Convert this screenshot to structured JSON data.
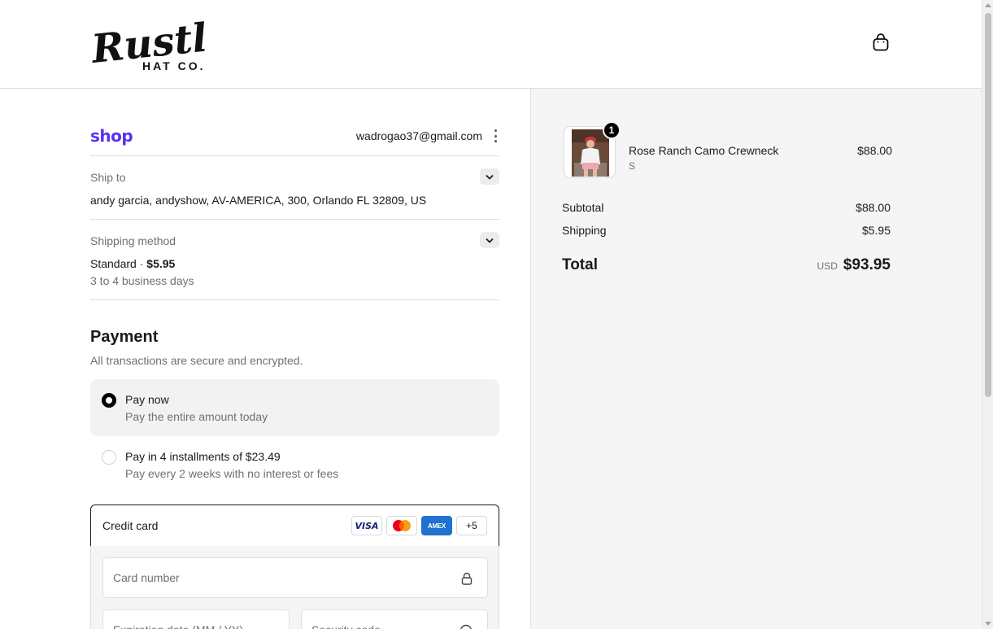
{
  "header": {
    "logo_script": "Rustler",
    "logo_sub": "HAT CO.",
    "cart_icon": "shopping-bag-icon"
  },
  "shop": {
    "brand": "shop",
    "email": "wadrogao37@gmail.com"
  },
  "ship_to": {
    "label": "Ship to",
    "value": "andy garcia, andyshow, AV-AMERICA, 300, Orlando FL 32809, US"
  },
  "shipping_method": {
    "label": "Shipping method",
    "name": "Standard",
    "separator": " · ",
    "price": "$5.95",
    "eta": "3 to 4 business days"
  },
  "payment": {
    "title": "Payment",
    "subtitle": "All transactions are secure and encrypted.",
    "options": [
      {
        "title": "Pay now",
        "subtitle": "Pay the entire amount today",
        "selected": true
      },
      {
        "title": "Pay in 4 installments of $23.49",
        "subtitle": "Pay every 2 weeks with no interest or fees",
        "selected": false
      }
    ],
    "credit_card": {
      "label": "Credit card",
      "card_brands": [
        "VISA",
        "mastercard",
        "AMEX"
      ],
      "more_label": "+5",
      "card_number_placeholder": "Card number",
      "expiration_placeholder": "Expiration date (MM / YY)",
      "security_placeholder": "Security code"
    }
  },
  "order": {
    "item": {
      "name": "Rose Ranch Camo Crewneck",
      "variant": "S",
      "price": "$88.00",
      "quantity": "1"
    },
    "subtotal_label": "Subtotal",
    "subtotal": "$88.00",
    "shipping_label": "Shipping",
    "shipping": "$5.95",
    "total_label": "Total",
    "currency": "USD",
    "total": "$93.95"
  },
  "colors": {
    "shop_brand": "#5a31f4",
    "summary_bg": "#f5f5f5",
    "amex": "#1f72cd",
    "visa": "#1a1f71"
  }
}
